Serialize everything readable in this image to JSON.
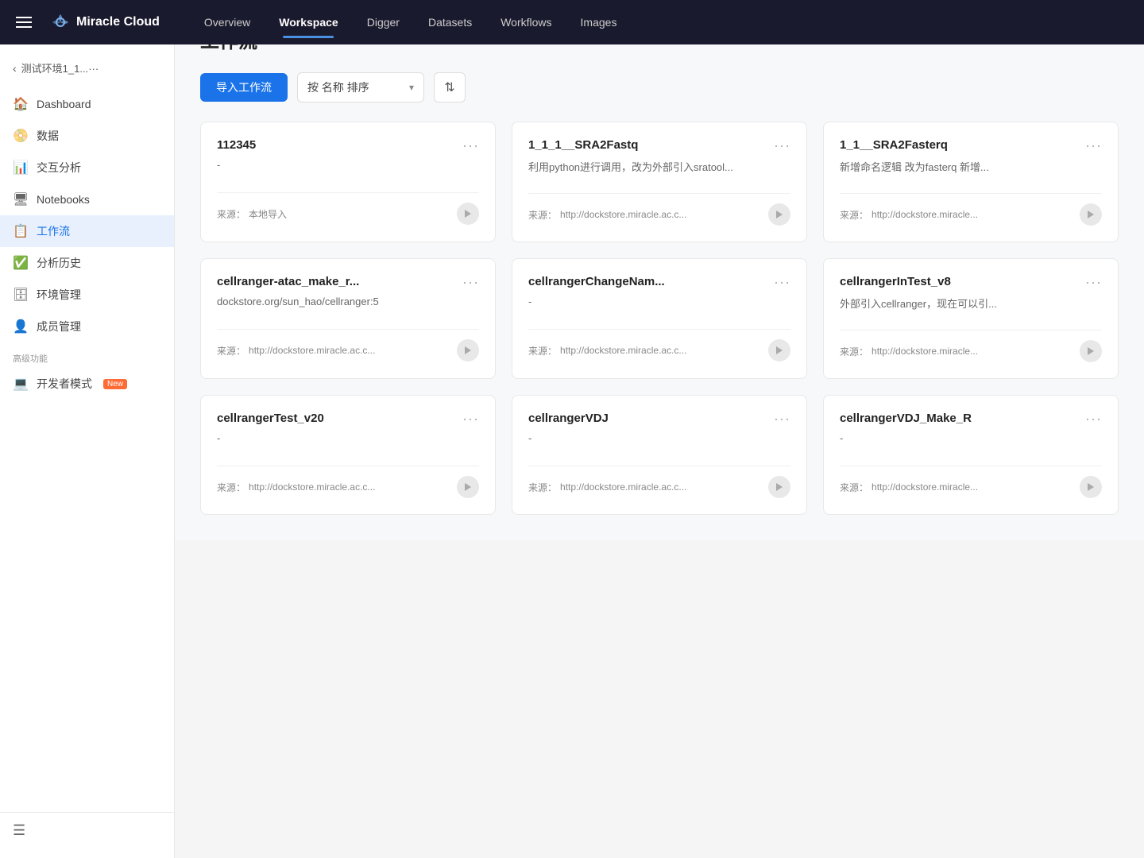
{
  "topnav": {
    "menu_icon": "☰",
    "brand": "Miracle Cloud",
    "links": [
      {
        "label": "Overview",
        "active": false
      },
      {
        "label": "Workspace",
        "active": true
      },
      {
        "label": "Digger",
        "active": false
      },
      {
        "label": "Datasets",
        "active": false
      },
      {
        "label": "Workflows",
        "active": false
      },
      {
        "label": "Images",
        "active": false
      }
    ]
  },
  "sidebar": {
    "back_text": "测试环境1_1...···",
    "items": [
      {
        "label": "Dashboard",
        "icon": "🏠",
        "active": false,
        "key": "dashboard"
      },
      {
        "label": "数据",
        "icon": "📀",
        "active": false,
        "key": "data"
      },
      {
        "label": "交互分析",
        "icon": "📊",
        "active": false,
        "key": "analysis"
      },
      {
        "label": "Notebooks",
        "icon": "🖥",
        "active": false,
        "key": "notebooks"
      },
      {
        "label": "工作流",
        "icon": "📋",
        "active": true,
        "key": "workflows"
      },
      {
        "label": "分析历史",
        "icon": "✅",
        "active": false,
        "key": "history"
      },
      {
        "label": "环境管理",
        "icon": "🗄",
        "active": false,
        "key": "env"
      },
      {
        "label": "成员管理",
        "icon": "👤",
        "active": false,
        "key": "members"
      }
    ],
    "advanced_label": "高级功能",
    "advanced_items": [
      {
        "label": "开发者模式",
        "icon": "💻",
        "badge": "New",
        "key": "developer"
      }
    ]
  },
  "main": {
    "page_title": "工作流",
    "toolbar": {
      "import_btn": "导入工作流",
      "sort_label": "按 名称 排序",
      "sort_toggle": "⇅"
    },
    "cards": [
      {
        "title": "112345",
        "desc": "-",
        "source_label": "来源：",
        "source_value": "本地导入",
        "more": "···"
      },
      {
        "title": "1_1_1__SRA2Fastq",
        "desc": "利用python进行调用，改为外部引入sratool...",
        "source_label": "来源：",
        "source_value": "http://dockstore.miracle.ac.c...",
        "more": "···"
      },
      {
        "title": "1_1__SRA2Fasterq",
        "desc": "新增命名逻辑 改为fasterq 新增...",
        "source_label": "来源：",
        "source_value": "http://dockstore.miracle...",
        "more": "···"
      },
      {
        "title": "cellranger-atac_make_r...",
        "desc": "dockstore.org/sun_hao/cellranger:5",
        "source_label": "来源：",
        "source_value": "http://dockstore.miracle.ac.c...",
        "more": "···"
      },
      {
        "title": "cellrangerChangeNam...",
        "desc": "-",
        "source_label": "来源：",
        "source_value": "http://dockstore.miracle.ac.c...",
        "more": "···"
      },
      {
        "title": "cellrangerInTest_v8",
        "desc": "外部引入cellranger，现在可以引...",
        "source_label": "来源：",
        "source_value": "http://dockstore.miracle...",
        "more": "···"
      },
      {
        "title": "cellrangerTest_v20",
        "desc": "-",
        "source_label": "来源：",
        "source_value": "http://dockstore.miracle.ac.c...",
        "more": "···"
      },
      {
        "title": "cellrangerVDJ",
        "desc": "-",
        "source_label": "来源：",
        "source_value": "http://dockstore.miracle.ac.c...",
        "more": "···"
      },
      {
        "title": "cellrangerVDJ_Make_R",
        "desc": "-",
        "source_label": "来源：",
        "source_value": "http://dockstore.miracle...",
        "more": "···"
      }
    ]
  }
}
